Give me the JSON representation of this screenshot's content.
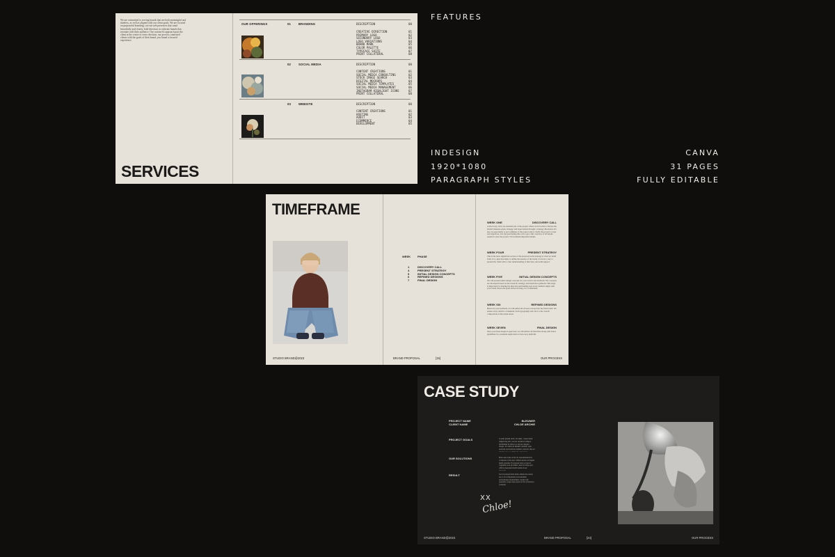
{
  "features": {
    "heading": "FEATURES",
    "left": [
      "INDESIGN",
      "1920*1080",
      "PARAGRAPH STYLES"
    ],
    "right": [
      "CANVA",
      "31 PAGES",
      "FULLY EDITABLE"
    ]
  },
  "services": {
    "title": "SERVICES",
    "intro": "We are committed to serving brands that are both meaningful and timeless, as well as aligned with our client goals. We are focused on purposeful branding, cut-out web presences that stand beautifully and clearly, bold direction to cultivate brands that resonate with their audience. Our custom-fit approach puts the client at the centre of every decision, our process connected clients with the goals of their brand, you brand a focused experience.",
    "offerings_label": "OUR OFFERINGS",
    "description_label": "DESCRIPTION",
    "description_num": "00",
    "sections": [
      {
        "num": "01",
        "name": "BRANDING",
        "items": [
          {
            "label": "CREATIVE DIRECTION",
            "num": "01"
          },
          {
            "label": "PRIMARY LOGO",
            "num": "02"
          },
          {
            "label": "SECONDARY LOGO",
            "num": "03"
          },
          {
            "label": "LOGO VARIATIONS",
            "num": "04"
          },
          {
            "label": "BRAND MARK",
            "num": "05"
          },
          {
            "label": "COLOR PALETTE",
            "num": "06"
          },
          {
            "label": "TYPEFACE SUITE",
            "num": "07"
          },
          {
            "label": "PRINT COLLATERAL",
            "num": "08"
          }
        ]
      },
      {
        "num": "02",
        "name": "SOCIAL MEDIA",
        "items": [
          {
            "label": "CONTENT CREATIONS",
            "num": "01"
          },
          {
            "label": "SOCIAL MEDIA CONSULTING",
            "num": "02"
          },
          {
            "label": "STOCK IMAGE SEARCH",
            "num": "03"
          },
          {
            "label": "DIGITAL MOCKUPS",
            "num": "04"
          },
          {
            "label": "SOCIAL MEDIA TEMPLATES",
            "num": "05"
          },
          {
            "label": "SOCIAL MEDIA MANAGEMENT",
            "num": "06"
          },
          {
            "label": "INSTAGRAM HIGHLIGHT ICONS",
            "num": "07"
          },
          {
            "label": "PRINT COLLATERAL",
            "num": "08"
          }
        ]
      },
      {
        "num": "03",
        "name": "WEBSITE",
        "items": [
          {
            "label": "CONTENT CREATIONS",
            "num": "01"
          },
          {
            "label": "HOSTING",
            "num": "02"
          },
          {
            "label": "AUDIT",
            "num": "03"
          },
          {
            "label": "ECOMMERCE",
            "num": "04"
          },
          {
            "label": "DEVELOPMENT",
            "num": "05"
          }
        ]
      }
    ]
  },
  "timeframe": {
    "title": "TIMEFRAME",
    "week_label": "WEEK",
    "phase_label": "PHASE",
    "rows": [
      {
        "week": "1",
        "phase": "DISCOVERY CALL"
      },
      {
        "week": "4",
        "phase": "PRESENT STRATEGY"
      },
      {
        "week": "5",
        "phase": "INITIAL DESIGN CONCEPTS"
      },
      {
        "week": "6",
        "phase": "REFINED DESIGNS"
      },
      {
        "week": "7",
        "phase": "FINAL DESIGN"
      }
    ],
    "weeks": [
      {
        "week": "WEEK ONE",
        "phase": "DISCOVERY CALL",
        "body": "A discovery call is an essential part of the project where we'll be able to discuss the brand's business goals, strategy, and expectations through a strategy discussion. It's also an opportunity to get a glimpse of the project and to clarify the project's scope and objectives. It is my goal during this call to get a full overview of all details needed to start the project. I'll document important details."
      },
      {
        "week": "WEEK FOUR",
        "phase": "PRESENT STRATEGY",
        "body": "This is the most significant section of the proposal as the strategy is what we build from. It's a plan that helps to define the essence of the brand. It can be a way to present the client with a clear understanding of direction, and solid support."
      },
      {
        "week": "WEEK FIVE",
        "phase": "INITIAL DESIGN CONCEPTS",
        "body": "We will present initial design concepts for your review and feedback. The concepts are developed based on the research, strategy, and inspiration gathered. This stage is important for shaping the direction and making sure every element aligns with your brand vision and goals before moving on to refinement."
      },
      {
        "week": "WEEK SIX",
        "phase": "REFINED DESIGNS",
        "body": "Based on your feedback, we will refine the chosen concept into the final brand. We ensure every detail is considered, from typography and color to the overall composition of the brand assets."
      },
      {
        "week": "WEEK SEVEN",
        "phase": "FINAL DESIGN",
        "body": "Once your final design is approved, we will deliver all final files along with brand guidelines for consistent application across every platform."
      }
    ],
    "footer_left": "STUDIO BRAND@2023",
    "footer_mid": "BRAND PROPOSAL",
    "footer_page": "[15]",
    "footer_right": "OUR PROCESS"
  },
  "case_study": {
    "title": "CASE STUDY",
    "project_name_label": "PROJECT NAME",
    "client_name_label": "CLIENT NAME",
    "project_name_value": "BLEUNER",
    "client_name_value": "CHLOE ARCHIE",
    "sections": [
      {
        "label": "PROJECT GOALS",
        "body": "Lorem ipsum dolor sit amet, consectetur adipiscing elit, sed do eiusmod tempor incididunt ut labore et dolore magna aliqua. Ut enim ad minim veniam, quis nostrud exercitation ullamco laboris nisi ut aliquip ex ea commodo consequat."
      },
      {
        "label": "OUR SOLUTIONS",
        "body": "Duis aute irure dolor in reprehenderit in voluptate velit esse cillum dolore eu fugiat nulla pariatur. Excepteur sint occaecat cupidatat non proident, sunt in culpa qui officia deserunt mollit anim id est laborum."
      },
      {
        "label": "RESULT",
        "body": "Sed ut perspiciatis unde omnis iste natus error sit voluptatem accusantium doloremque laudantium, totam rem aperiam, eaque ipsa quae ab illo inventore veritatis."
      }
    ],
    "signoff_xx": "XX",
    "signature": "Chloe!",
    "footer_left": "STUDIO BRAND@2023",
    "footer_mid": "BRAND PROPOSAL",
    "footer_page": "[24]",
    "footer_right": "OUR PROCESS"
  }
}
